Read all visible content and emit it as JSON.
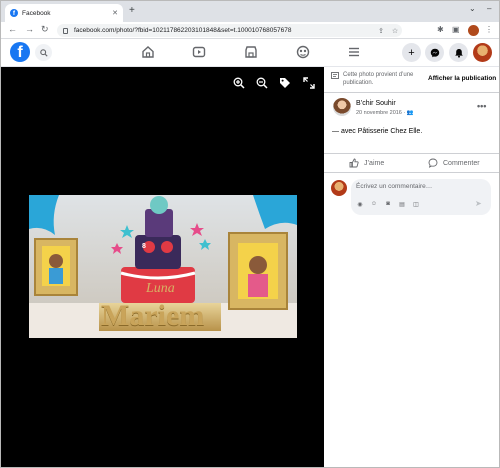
{
  "browser": {
    "tab_title": "Facebook",
    "tab_close": "✕",
    "new_tab": "+",
    "url": "facebook.com/photo/?fbid=102117862203101848&set=t.100010768057678",
    "back": "←",
    "forward": "→",
    "reload": "↻"
  },
  "viewer": {
    "cake_topper": "Mariem",
    "cake_name": "Luna",
    "cake_number": "8"
  },
  "panel": {
    "notice_text": "Cette photo provient d’une publication.",
    "notice_link": "Afficher la publication",
    "author": "B’chir Souhir",
    "date": "20 novembre 2016 ·",
    "caption_prefix": "— avec ",
    "caption_page": "Pâtisserie Chez Elle",
    "caption_suffix": ".",
    "like_label": "J’aime",
    "comment_label": "Commenter",
    "comment_placeholder": "Écrivez un commentaire…"
  }
}
